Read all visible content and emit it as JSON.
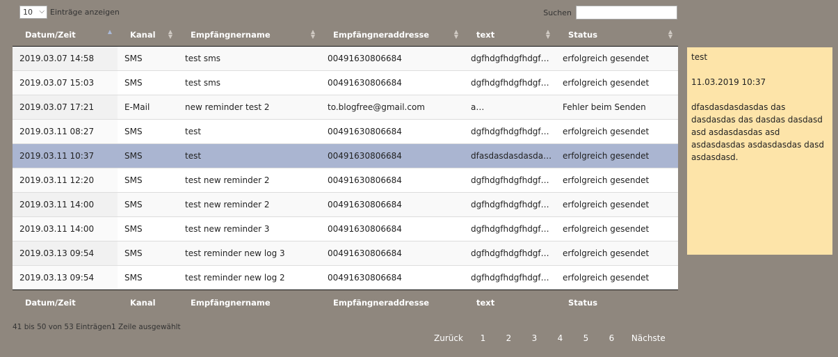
{
  "length": {
    "value": "10",
    "label": "Einträge anzeigen"
  },
  "search": {
    "label": "Suchen",
    "value": ""
  },
  "columns": [
    "Datum/Zeit",
    "Kanal",
    "Empfängnername",
    "Empfängneraddresse",
    "text",
    "Status"
  ],
  "rows": [
    {
      "datetime": "2019.03.07 14:58",
      "channel": "SMS",
      "name": "test sms",
      "address": "00491630806684",
      "text": "dgfhdgfhdgfhdgf…",
      "status": "erfolgreich gesendet"
    },
    {
      "datetime": "2019.03.07 15:03",
      "channel": "SMS",
      "name": "test sms",
      "address": "00491630806684",
      "text": "dgfhdgfhdgfhdgf…",
      "status": "erfolgreich gesendet"
    },
    {
      "datetime": "2019.03.07 17:21",
      "channel": "E-Mail",
      "name": "new reminder test 2",
      "address": "to.blogfree@gmail.com",
      "text": "a…",
      "status": "Fehler beim Senden"
    },
    {
      "datetime": "2019.03.11 08:27",
      "channel": "SMS",
      "name": "test",
      "address": "00491630806684",
      "text": "dgfhdgfhdgfhdgf…",
      "status": "erfolgreich gesendet"
    },
    {
      "datetime": "2019.03.11 10:37",
      "channel": "SMS",
      "name": "test",
      "address": "00491630806684",
      "text": "dfasdasdasdasda…",
      "status": "erfolgreich gesendet"
    },
    {
      "datetime": "2019.03.11 12:20",
      "channel": "SMS",
      "name": "test new reminder 2",
      "address": "00491630806684",
      "text": "dgfhdgfhdgfhdgf…",
      "status": "erfolgreich gesendet"
    },
    {
      "datetime": "2019.03.11 14:00",
      "channel": "SMS",
      "name": "test new reminder 2",
      "address": "00491630806684",
      "text": "dgfhdgfhdgfhdgf…",
      "status": "erfolgreich gesendet"
    },
    {
      "datetime": "2019.03.11 14:00",
      "channel": "SMS",
      "name": "test new reminder 3",
      "address": "00491630806684",
      "text": "dgfhdgfhdgfhdgf…",
      "status": "erfolgreich gesendet"
    },
    {
      "datetime": "2019.03.13 09:54",
      "channel": "SMS",
      "name": "test reminder new log 3",
      "address": "00491630806684",
      "text": "dgfhdgfhdgfhdgf…",
      "status": "erfolgreich gesendet"
    },
    {
      "datetime": "2019.03.13 09:54",
      "channel": "SMS",
      "name": "test reminder new log 2",
      "address": "00491630806684",
      "text": "dgfhdgfhdgfhdgf…",
      "status": "erfolgreich gesendet"
    }
  ],
  "info": "41 bis 50 von 53 Einträgen1 Zeile ausgewählt",
  "pagination": {
    "previous": "Zurück",
    "pages": [
      "1",
      "2",
      "3",
      "4",
      "5",
      "6"
    ],
    "next": "Nächste"
  },
  "detail": {
    "title": "test",
    "timestamp": "11.03.2019 10:37",
    "body": "dfasdasdasdasdas das dasdasdas das dasdas dasdasd asd asdasdasdas asd asdasdasdas asdasdasdas dasd asdasdasd."
  },
  "colors": {
    "background": "#8f877e",
    "selected_row": "#aab5d1",
    "detail_panel": "#fde4a9"
  }
}
